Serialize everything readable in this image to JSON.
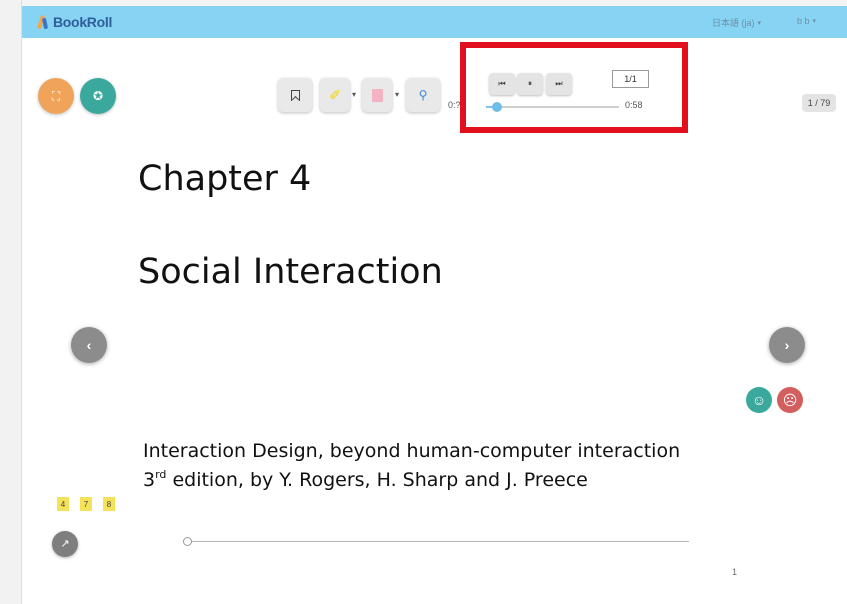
{
  "header": {
    "brand": "BookRoll",
    "language_label": "日本語 (ja)",
    "user_label": "b b",
    "caret": "▾"
  },
  "side_buttons": {
    "fullscreen_icon": "⛶",
    "star_icon": "✪",
    "prev_icon": "‹",
    "next_icon": "›",
    "happy_icon": "☺",
    "sad_icon": "☹",
    "expand_icon": "↗"
  },
  "toolbar": {
    "bookmark_icon": "bookmark-icon",
    "highlight_icon": "✐",
    "memo_icon": "memo-icon",
    "search_icon": "⚲",
    "dropdown_caret": "▾"
  },
  "player": {
    "prev_glyph": "⏮",
    "pause_glyph": "⏸",
    "next_glyph": "⏭",
    "track_counter": "1/1",
    "current_time": "0:??",
    "total_time": "0:58",
    "progress_fraction": 0.08
  },
  "page_indicator": "1 / 79",
  "slide": {
    "title": "Chapter 4",
    "subtitle": "Social Interaction",
    "book_line1": "Interaction Design, beyond human-computer interaction",
    "book_line2_prefix": "3",
    "book_line2_sup": "rd",
    "book_line2_rest": " edition, by Y. Rogers, H. Sharp and J. Preece",
    "slide_number": "1"
  },
  "memo_tags": [
    "4",
    "7",
    "8"
  ],
  "colors": {
    "topbar": "#86d3f4",
    "accent_orange": "#f0a45a",
    "accent_teal": "#3aa89c",
    "accent_red": "#d25e5e",
    "highlight_frame": "#e1101c"
  }
}
